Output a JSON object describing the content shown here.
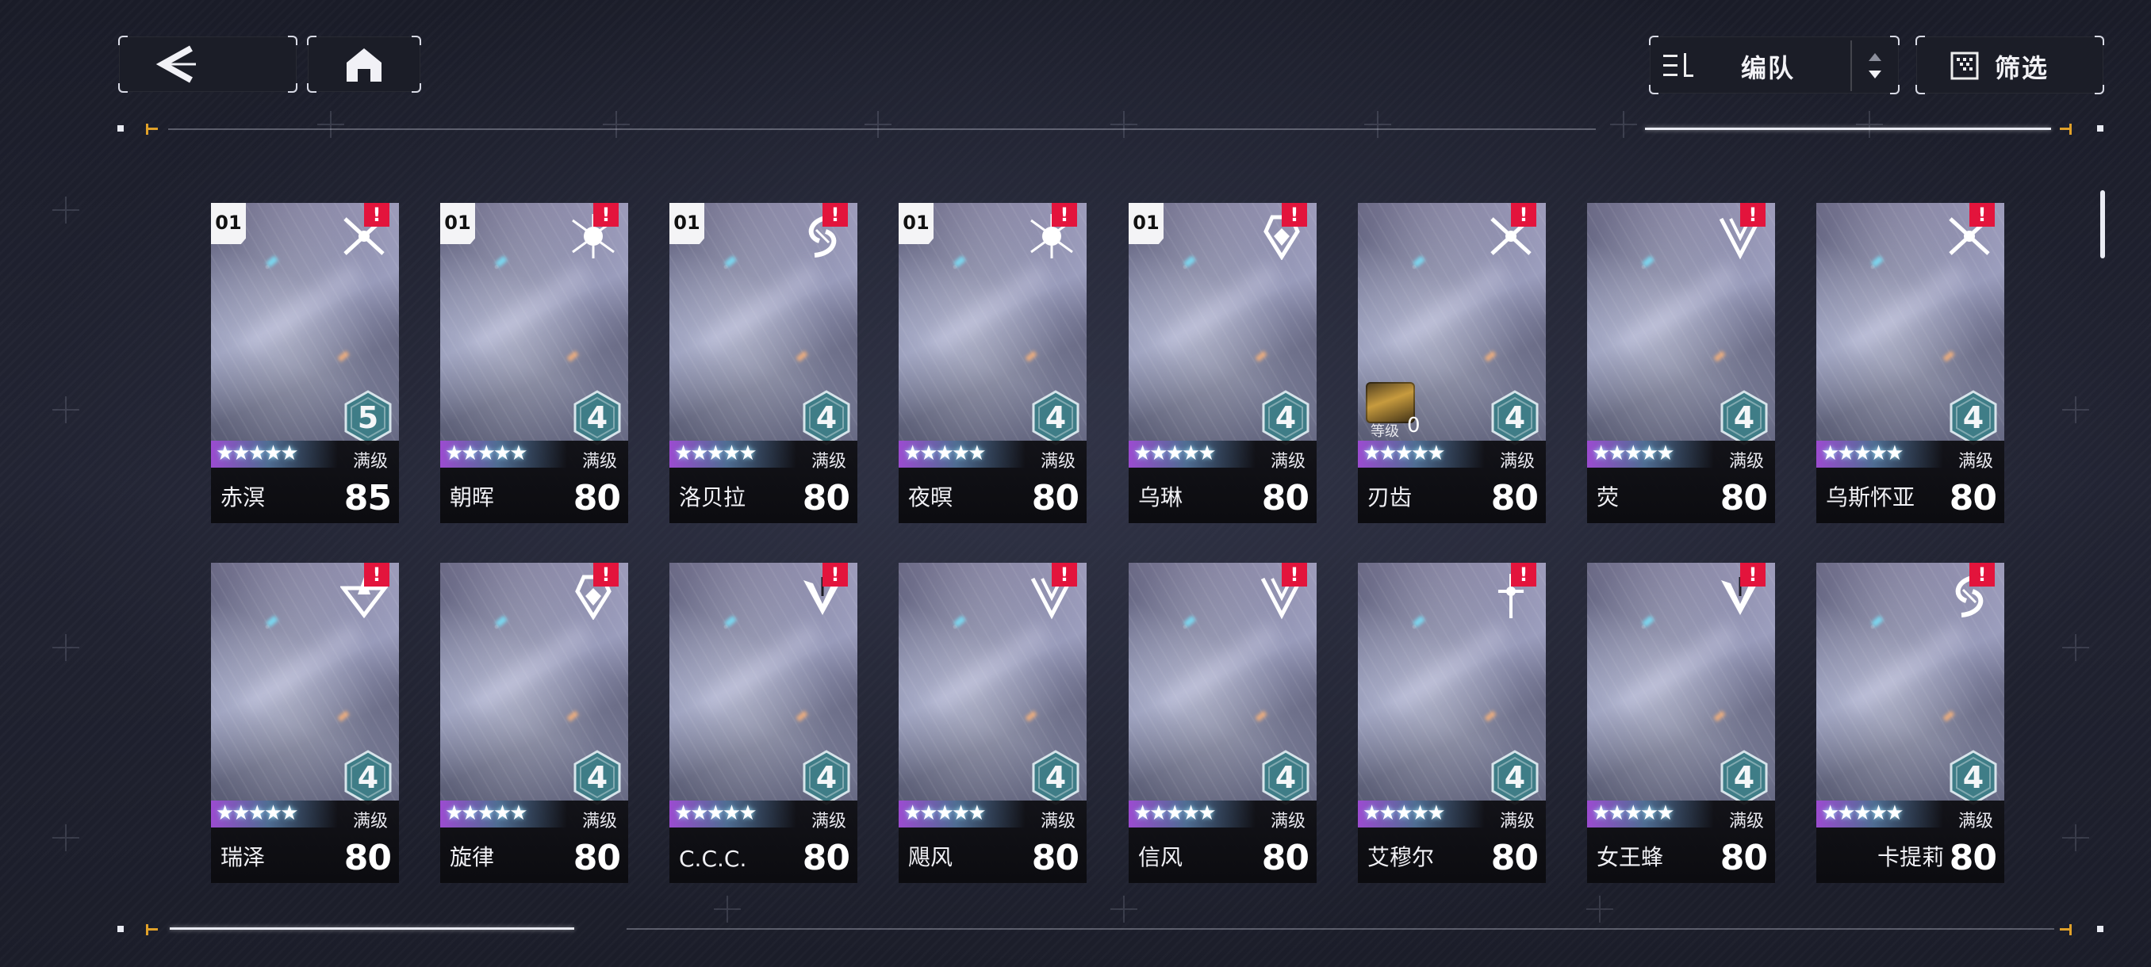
{
  "top_bar": {
    "back_icon": "back-arrow-icon",
    "home_icon": "home-icon",
    "sort_icon": "sort-list-icon",
    "sort_label": "编队",
    "sort_toggle_icon": "sort-order-icon",
    "filter_icon": "filter-grid-icon",
    "filter_label": "筛选"
  },
  "card_labels": {
    "max_level": "满级",
    "weapon_level_label": "等级"
  },
  "colors": {
    "alert": "#e3143c",
    "rank_badge": "#3f7d87",
    "accent_tick": "#e0a12a"
  },
  "characters": [
    {
      "squad": "01",
      "class_icon": "crossed-blades-icon",
      "rank": "5",
      "stars": "★★★★★",
      "name": "赤溟",
      "level": "85",
      "alert": "!"
    },
    {
      "squad": "01",
      "class_icon": "spiked-skull-icon",
      "rank": "4",
      "stars": "★★★★★",
      "name": "朝晖",
      "level": "80",
      "alert": "!"
    },
    {
      "squad": "01",
      "class_icon": "swirl-blade-icon",
      "rank": "4",
      "stars": "★★★★★",
      "name": "洛贝拉",
      "level": "80",
      "alert": "!"
    },
    {
      "squad": "01",
      "class_icon": "spiked-skull-icon",
      "rank": "4",
      "stars": "★★★★★",
      "name": "夜暝",
      "level": "80",
      "alert": "!"
    },
    {
      "squad": "01",
      "class_icon": "shield-crystal-icon",
      "rank": "4",
      "stars": "★★★★★",
      "name": "乌琳",
      "level": "80",
      "alert": "!"
    },
    {
      "squad": "",
      "class_icon": "crossed-blades-icon",
      "rank": "4",
      "stars": "★★★★★",
      "name": "刃齿",
      "level": "80",
      "alert": "!",
      "weapon_level": "0"
    },
    {
      "squad": "",
      "class_icon": "triple-chevron-icon",
      "rank": "4",
      "stars": "★★★★★",
      "name": "荧",
      "level": "80",
      "alert": "!"
    },
    {
      "squad": "",
      "class_icon": "crossed-blades-icon",
      "rank": "4",
      "stars": "★★★★★",
      "name": "乌斯怀亚",
      "level": "80",
      "alert": "!"
    },
    {
      "squad": "",
      "class_icon": "triangle-wing-icon",
      "rank": "4",
      "stars": "★★★★★",
      "name": "瑞泽",
      "level": "80",
      "alert": "!"
    },
    {
      "squad": "",
      "class_icon": "shield-crystal-icon",
      "rank": "4",
      "stars": "★★★★★",
      "name": "旋律",
      "level": "80",
      "alert": "!"
    },
    {
      "squad": "",
      "class_icon": "wing-claw-icon",
      "rank": "4",
      "stars": "★★★★★",
      "name": "C.C.C.",
      "level": "80",
      "alert": "!"
    },
    {
      "squad": "",
      "class_icon": "triple-chevron-icon",
      "rank": "4",
      "stars": "★★★★★",
      "name": "飓风",
      "level": "80",
      "alert": "!"
    },
    {
      "squad": "",
      "class_icon": "triple-chevron-icon",
      "rank": "4",
      "stars": "★★★★★",
      "name": "信风",
      "level": "80",
      "alert": "!"
    },
    {
      "squad": "",
      "class_icon": "star-sword-icon",
      "rank": "4",
      "stars": "★★★★★",
      "name": "艾穆尔",
      "level": "80",
      "alert": "!"
    },
    {
      "squad": "",
      "class_icon": "wing-claw-icon",
      "rank": "4",
      "stars": "★★★★★",
      "name": "女王蜂",
      "level": "80",
      "alert": "!"
    },
    {
      "squad": "",
      "class_icon": "swirl-blade-icon",
      "rank": "4",
      "stars": "★★★★★",
      "name": "卡提莉",
      "level": "80",
      "alert": "!"
    }
  ]
}
